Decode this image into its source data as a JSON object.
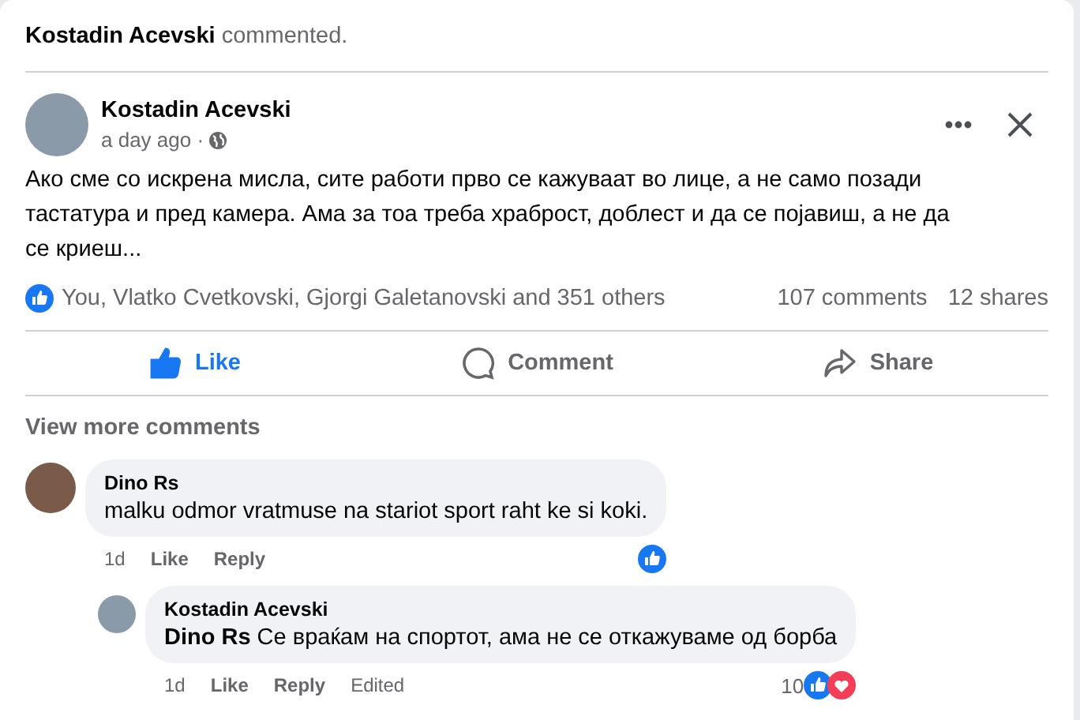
{
  "header": {
    "actor": "Kostadin Acevski",
    "action": "commented."
  },
  "post": {
    "author": "Kostadin Acevski",
    "time": "a day ago ·",
    "text": "Ако сме со искрена мисла, сите работи прво се кажуваат во лице, а не само позади тастатура и пред камера. Ама за тоа треба храброст, доблест и да се појавиш, а не да се криеш...",
    "reactions_text": "You, Vlatko Cvetkovski, Gjorgi Galetanovski and 351 others",
    "comments_count": "107 comments",
    "shares_count": "12 shares"
  },
  "actions": [
    {
      "kind": "like",
      "label": "Like",
      "selected": true
    },
    {
      "kind": "comment",
      "label": "Comment",
      "selected": false
    },
    {
      "kind": "share",
      "label": "Share",
      "selected": false
    }
  ],
  "view_more": "View more comments",
  "comments": [
    {
      "author": "Dino Rs",
      "text": "malku odmor vratmuse na stariot sport raht ke si koki.",
      "time": "1d",
      "like": "Like",
      "reply": "Reply",
      "reacted_like": true,
      "children": [
        {
          "author": "Kostadin Acevski",
          "text": "**Dino Rs** Се враќам на спортот, ама не се откажуваме од борба",
          "time": "1d",
          "like": "Like",
          "reply": "Reply",
          "edited": "Edited",
          "reaction_count": "10",
          "reacted_like": true,
          "reacted_love": true
        }
      ]
    }
  ]
}
